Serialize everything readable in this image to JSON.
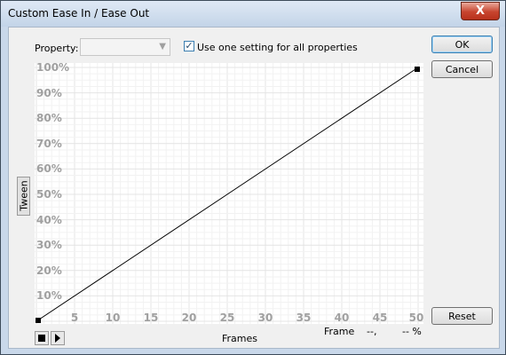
{
  "window": {
    "title": "Custom Ease In / Ease Out",
    "close_glyph": "X"
  },
  "property": {
    "label": "Property:",
    "selected_value": ""
  },
  "use_one_setting": {
    "label": "Use one setting for all properties",
    "checked": true
  },
  "buttons": {
    "ok": "OK",
    "cancel": "Cancel",
    "reset": "Reset"
  },
  "graph": {
    "y_axis_title": "Tween",
    "x_axis_title": "Frames",
    "y_ticks": [
      "100%",
      "90%",
      "80%",
      "70%",
      "60%",
      "50%",
      "40%",
      "30%",
      "20%",
      "10%"
    ],
    "x_ticks": [
      "5",
      "10",
      "15",
      "20",
      "25",
      "30",
      "35",
      "40",
      "45",
      "50"
    ],
    "curve": {
      "start": {
        "frame": 0,
        "percent": 0
      },
      "end": {
        "frame": 50,
        "percent": 100
      }
    }
  },
  "readout": {
    "frame_label": "Frame",
    "frame_value": "--,",
    "percent_value": "-- %"
  },
  "playback": {
    "stop_icon": "stop-icon",
    "play_icon": "play-icon"
  }
}
